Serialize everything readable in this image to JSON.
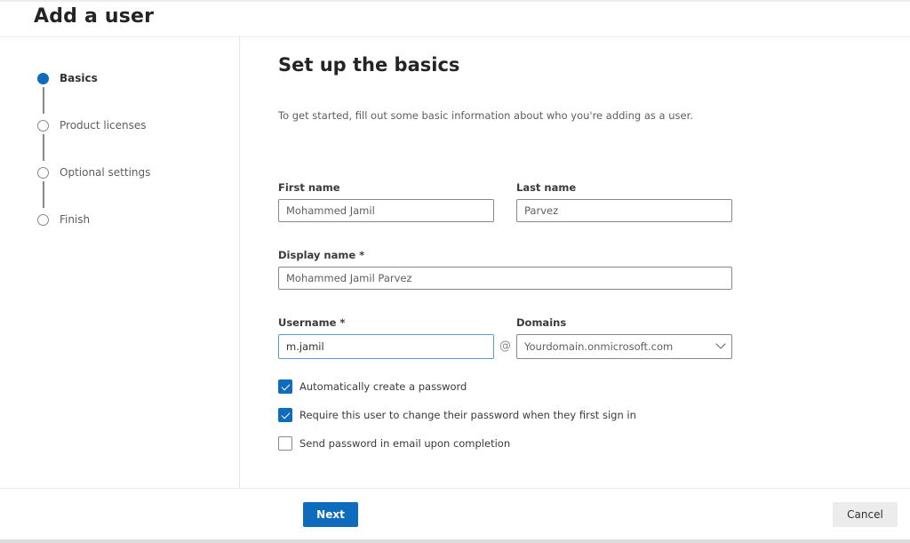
{
  "header": {
    "title": "Add a user"
  },
  "steps": [
    {
      "label": "Basics",
      "state": "active"
    },
    {
      "label": "Product licenses",
      "state": "pending"
    },
    {
      "label": "Optional settings",
      "state": "pending"
    },
    {
      "label": "Finish",
      "state": "pending"
    }
  ],
  "main": {
    "title": "Set up the basics",
    "intro": "To get started, fill out some basic information about who you're adding as a user.",
    "fields": {
      "first_name": {
        "label": "First name",
        "value": "Mohammed Jamil"
      },
      "last_name": {
        "label": "Last name",
        "value": "Parvez"
      },
      "display_name": {
        "label": "Display name *",
        "value": "Mohammed Jamil Parvez"
      },
      "username": {
        "label": "Username *",
        "value": "m.jamil"
      },
      "at_symbol": "@",
      "domains": {
        "label": "Domains",
        "value": "Yourdomain.onmicrosoft.com"
      }
    },
    "checkboxes": [
      {
        "label": "Automatically create a password",
        "checked": true
      },
      {
        "label": "Require this user to change their password when they first sign in",
        "checked": true
      },
      {
        "label": "Send password in email upon completion",
        "checked": false
      }
    ]
  },
  "footer": {
    "next_label": "Next",
    "cancel_label": "Cancel"
  },
  "colors": {
    "accent": "#0f6cbd",
    "cancel_bg": "#ececec"
  }
}
